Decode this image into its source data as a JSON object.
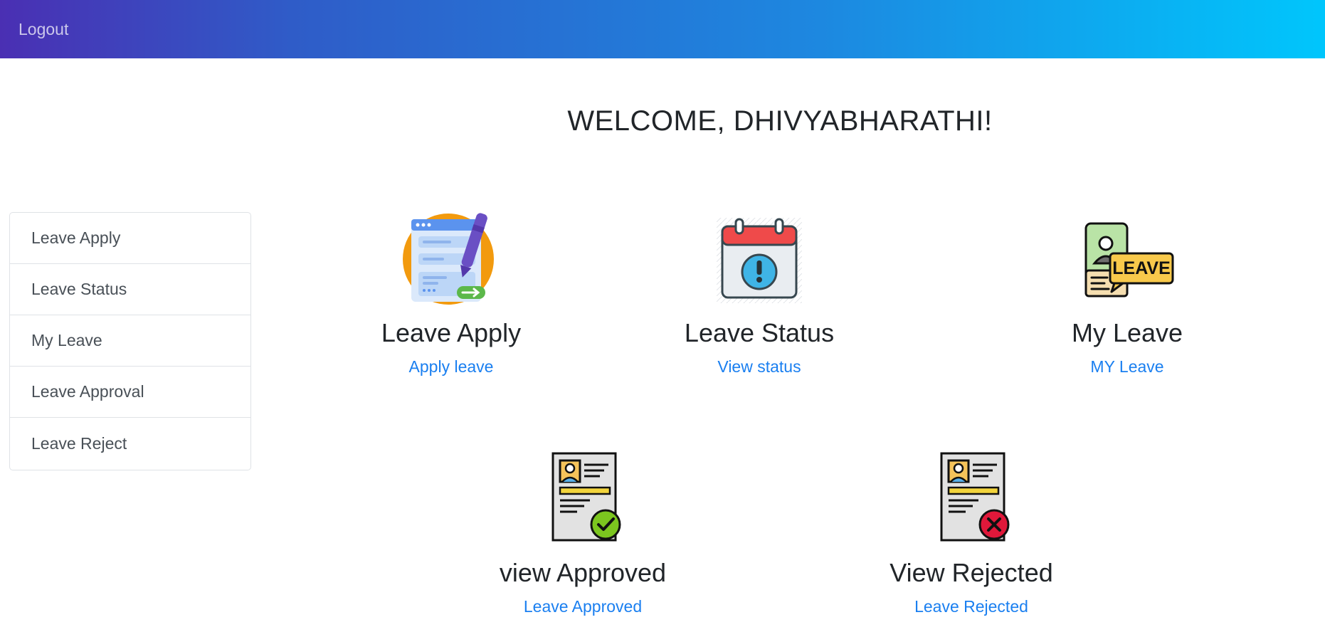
{
  "nav": {
    "logout_label": "Logout"
  },
  "welcome": "WELCOME, DHIVYABHARATHI!",
  "sidebar": {
    "items": [
      {
        "label": "Leave Apply"
      },
      {
        "label": "Leave Status"
      },
      {
        "label": "My Leave"
      },
      {
        "label": "Leave Approval"
      },
      {
        "label": "Leave Reject"
      }
    ]
  },
  "cards": [
    {
      "title": "Leave Apply",
      "link": "Apply leave",
      "icon": "form-pen-icon"
    },
    {
      "title": "Leave Status",
      "link": "View status",
      "icon": "calendar-alert-icon"
    },
    {
      "title": "My Leave",
      "link": "MY Leave",
      "icon": "id-card-leave-icon",
      "badge": "LEAVE"
    },
    {
      "title": "view Approved",
      "link": "Leave Approved",
      "icon": "document-approved-icon"
    },
    {
      "title": "View Rejected",
      "link": "Leave Rejected",
      "icon": "document-rejected-icon"
    }
  ],
  "colors": {
    "header_gradient_start": "#4a2fb3",
    "header_gradient_end": "#00c6fc",
    "link": "#1a7ff0",
    "approved": "#7cc61f",
    "rejected": "#e0183a"
  }
}
